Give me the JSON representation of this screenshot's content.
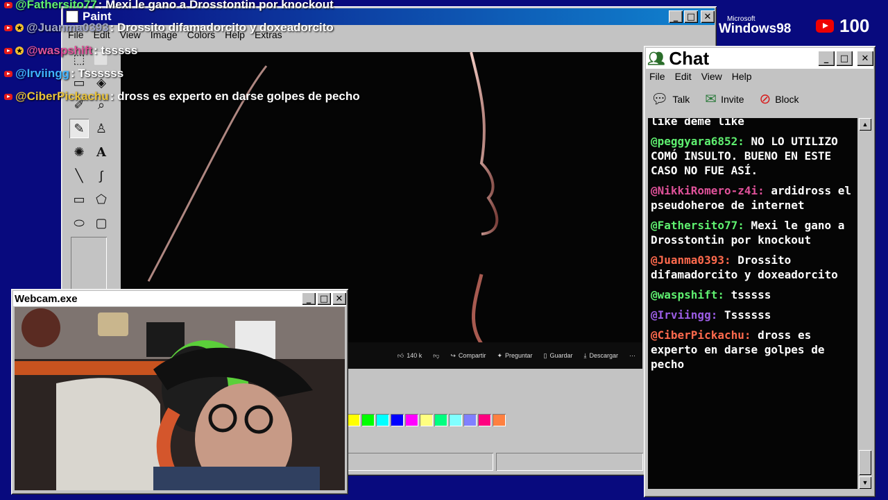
{
  "paint": {
    "title": "Paint",
    "menu": [
      "File",
      "Edit",
      "View",
      "Image",
      "Colors",
      "Help",
      "Extras"
    ],
    "video_bar": {
      "likes": "140 k",
      "share": "Compartir",
      "ask": "Preguntar",
      "save": "Guardar",
      "download": "Descargar"
    },
    "palette": [
      "#ffff00",
      "#00ff00",
      "#00ffff",
      "#0000ff",
      "#ff00ff",
      "#ffff80",
      "#00ff80",
      "#80ffff",
      "#8080ff",
      "#ff0080",
      "#ff8040"
    ]
  },
  "webcam": {
    "title": "Webcam.exe"
  },
  "chat": {
    "title": "Chat",
    "menu": [
      "File",
      "Edit",
      "View",
      "Help"
    ],
    "toolbar": {
      "talk": "Talk",
      "invite": "Invite",
      "block": "Block"
    },
    "partial_top": "like deme like",
    "messages": [
      {
        "user": "@peggyara6852:",
        "text": "NO LO UTILIZO COMÓ INSULTO. BUENO EN ESTE CASO NO FUE ASÍ.",
        "color": "#5ff070"
      },
      {
        "user": "@NikkiRomero-z4i:",
        "text": "ardidross el pseudoheroe de internet",
        "color": "#e0529a"
      },
      {
        "user": "@Fathersito77:",
        "text": "Mexi le gano a Drosstontin por knockout",
        "color": "#5ff070"
      },
      {
        "user": "@Juanma0393:",
        "text": "Drossito difamadorcito y doxeadorcito",
        "color": "#ff6a4d"
      },
      {
        "user": "@waspshift:",
        "text": "tsssss",
        "color": "#5ff070"
      },
      {
        "user": "@Irviingg:",
        "text": "Tssssss",
        "color": "#9b5de5"
      },
      {
        "user": "@CiberPickachu:",
        "text": "dross es experto en darse golpes de pecho",
        "color": "#ff6a4d"
      }
    ]
  },
  "overlay_feed": [
    {
      "user": "@Fathersito77",
      "text": ": Mexi le gano a Drosstontin por knockout",
      "color": "#5ff070",
      "star": false
    },
    {
      "user": "@Juanma0393",
      "text": ": Drossito difamadorcito y doxeadorcito",
      "color": "#9fa6c9",
      "star": true
    },
    {
      "user": "@waspshift",
      "text": ": tsssss",
      "color": "#e0529a",
      "star": true
    },
    {
      "user": "@Irviingg",
      "text": ": Tssssss",
      "color": "#3fb3ff",
      "star": false
    },
    {
      "user": "@CiberPickachu",
      "text": ": dross es experto en darse golpes de pecho",
      "color": "#e8c23b",
      "star": false
    }
  ],
  "logo": {
    "microsoft": "Microsoft",
    "windows": "Windows98"
  },
  "subscriber_count": "100"
}
